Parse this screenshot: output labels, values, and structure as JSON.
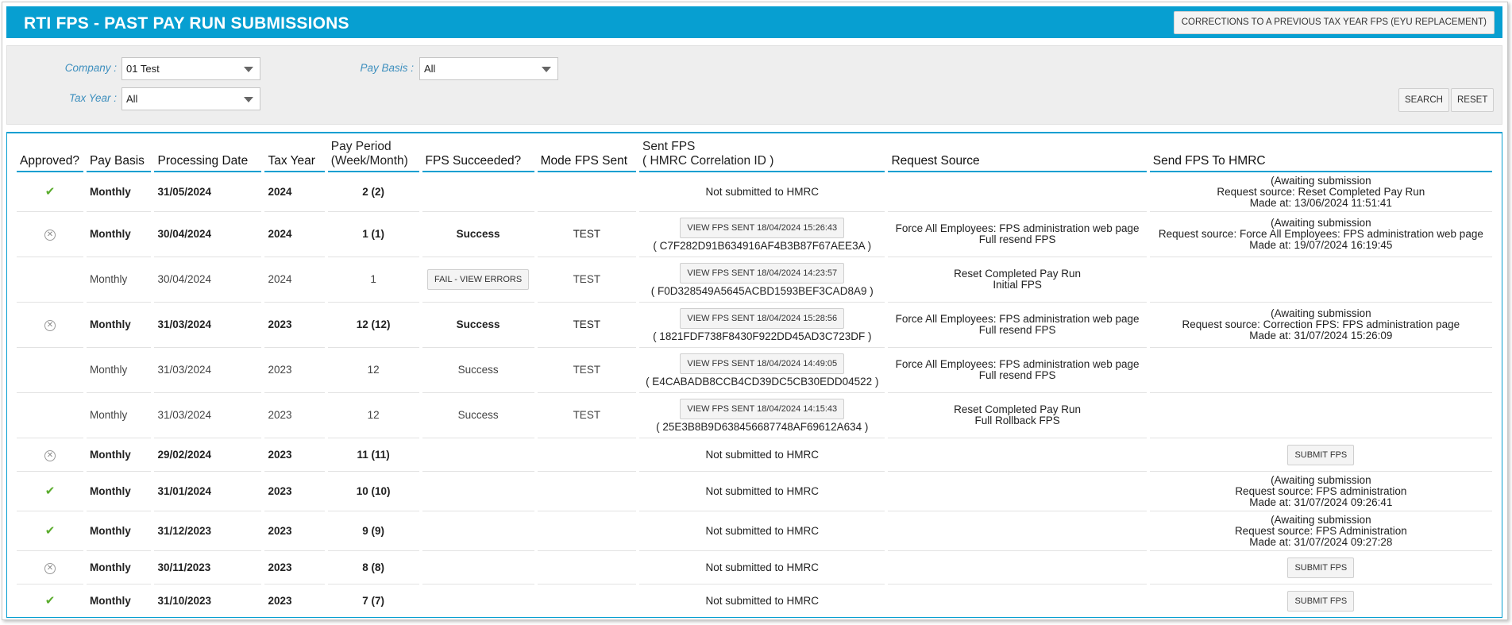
{
  "header": {
    "title": "RTI FPS - PAST PAY RUN SUBMISSIONS",
    "corrections_button": "CORRECTIONS TO A PREVIOUS TAX YEAR FPS (EYU REPLACEMENT)"
  },
  "filters": {
    "company_label": "Company :",
    "company_value": "01 Test",
    "pay_basis_label": "Pay Basis :",
    "pay_basis_value": "All",
    "tax_year_label": "Tax Year :",
    "tax_year_value": "All",
    "search_button": "SEARCH",
    "reset_button": "RESET"
  },
  "colors": {
    "accent": "#079fd1",
    "approved": "#5aac2d"
  },
  "table": {
    "headers": {
      "approved": "Approved?",
      "pay_basis": "Pay Basis",
      "processing_date": "Processing Date",
      "tax_year": "Tax Year",
      "pay_period_1": "Pay Period",
      "pay_period_2": "(Week/Month)",
      "fps_succeeded": "FPS Succeeded?",
      "mode": "Mode FPS Sent",
      "sent_fps_1": "Sent FPS",
      "sent_fps_2": "( HMRC Correlation ID )",
      "request_source": "Request Source",
      "send_fps": "Send FPS To HMRC"
    },
    "rows": [
      {
        "approved": "✔",
        "approved_icon": "check-icon",
        "pay_basis": "Monthly",
        "processing_date": "31/05/2024",
        "tax_year": "2024",
        "pay_period": "2 (2)",
        "fps_succeeded": "",
        "mode": "",
        "sent_fps": "Not submitted to HMRC",
        "request_source_1": "",
        "request_source_2": "",
        "send_1": "(Awaiting submission",
        "send_2": "Request source: Reset Completed Pay Run",
        "send_3": "Made at: 13/06/2024 11:51:41"
      },
      {
        "approved": "✕",
        "approved_icon": "unapproved-icon",
        "pay_basis": "Monthly",
        "processing_date": "30/04/2024",
        "tax_year": "2024",
        "pay_period": "1 (1)",
        "fps_succeeded": "Success",
        "mode": "TEST",
        "view_button": "VIEW FPS SENT 18/04/2024 15:26:43",
        "correlation_id": "( C7F282D91B634916AF4B3B87F67AEE3A )",
        "request_source_1": "Force All Employees: FPS administration web page",
        "request_source_2": "Full resend FPS",
        "send_1": "(Awaiting submission",
        "send_2": "Request source: Force All Employees: FPS administration web page",
        "send_3": "Made at: 19/07/2024 16:19:45"
      },
      {
        "pay_basis": "Monthly",
        "processing_date": "30/04/2024",
        "tax_year": "2024",
        "pay_period": "1",
        "fail_button": "FAIL - VIEW ERRORS",
        "mode": "TEST",
        "view_button": "VIEW FPS SENT 18/04/2024 14:23:57",
        "correlation_id": "( F0D328549A5645ACBD1593BEF3CAD8A9 )",
        "request_source_1": "Reset Completed Pay Run",
        "request_source_2": "Initial FPS"
      },
      {
        "approved": "✕",
        "approved_icon": "unapproved-icon",
        "pay_basis": "Monthly",
        "processing_date": "31/03/2024",
        "tax_year": "2023",
        "pay_period": "12 (12)",
        "fps_succeeded": "Success",
        "mode": "TEST",
        "view_button": "VIEW FPS SENT 18/04/2024 15:28:56",
        "correlation_id": "( 1821FDF738F8430F922DD45AD3C723DF )",
        "request_source_1": "Force All Employees: FPS administration web page",
        "request_source_2": "Full resend FPS",
        "send_1": "(Awaiting submission",
        "send_2": "Request source: Correction FPS: FPS administration page",
        "send_3": "Made at: 31/07/2024 15:26:09"
      },
      {
        "pay_basis": "Monthly",
        "processing_date": "31/03/2024",
        "tax_year": "2023",
        "pay_period": "12",
        "fps_succeeded": "Success",
        "mode": "TEST",
        "view_button": "VIEW FPS SENT 18/04/2024 14:49:05",
        "correlation_id": "( E4CABADB8CCB4CD39DC5CB30EDD04522 )",
        "request_source_1": "Force All Employees: FPS administration web page",
        "request_source_2": "Full resend FPS"
      },
      {
        "pay_basis": "Monthly",
        "processing_date": "31/03/2024",
        "tax_year": "2023",
        "pay_period": "12",
        "fps_succeeded": "Success",
        "mode": "TEST",
        "view_button": "VIEW FPS SENT 18/04/2024 14:15:43",
        "correlation_id": "( 25E3B8B9D638456687748AF69612A634 )",
        "request_source_1": "Reset Completed Pay Run",
        "request_source_2": "Full Rollback FPS"
      },
      {
        "approved": "✕",
        "approved_icon": "unapproved-icon",
        "pay_basis": "Monthly",
        "processing_date": "29/02/2024",
        "tax_year": "2023",
        "pay_period": "11 (11)",
        "sent_fps": "Not submitted to HMRC",
        "submit_button": "SUBMIT FPS"
      },
      {
        "approved": "✔",
        "approved_icon": "check-icon",
        "pay_basis": "Monthly",
        "processing_date": "31/01/2024",
        "tax_year": "2023",
        "pay_period": "10 (10)",
        "sent_fps": "Not submitted to HMRC",
        "send_1": "(Awaiting submission",
        "send_2": "Request source: FPS administration",
        "send_3": "Made at: 31/07/2024 09:26:41"
      },
      {
        "approved": "✔",
        "approved_icon": "check-icon",
        "pay_basis": "Monthly",
        "processing_date": "31/12/2023",
        "tax_year": "2023",
        "pay_period": "9 (9)",
        "sent_fps": "Not submitted to HMRC",
        "send_1": "(Awaiting submission",
        "send_2": "Request source: FPS Administration",
        "send_3": "Made at: 31/07/2024 09:27:28"
      },
      {
        "approved": "✕",
        "approved_icon": "unapproved-icon",
        "pay_basis": "Monthly",
        "processing_date": "30/11/2023",
        "tax_year": "2023",
        "pay_period": "8 (8)",
        "sent_fps": "Not submitted to HMRC",
        "submit_button": "SUBMIT FPS"
      },
      {
        "approved": "✔",
        "approved_icon": "check-icon",
        "pay_basis": "Monthly",
        "processing_date": "31/10/2023",
        "tax_year": "2023",
        "pay_period": "7 (7)",
        "sent_fps": "Not submitted to HMRC",
        "submit_button": "SUBMIT FPS"
      }
    ]
  }
}
